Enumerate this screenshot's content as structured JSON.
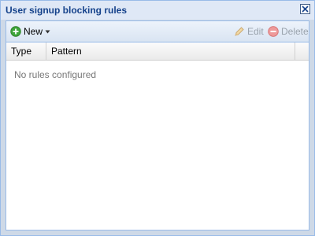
{
  "window": {
    "title": "User signup blocking rules"
  },
  "toolbar": {
    "new_label": "New",
    "edit_label": "Edit",
    "delete_label": "Delete"
  },
  "grid": {
    "columns": [
      "Type",
      "Pattern"
    ],
    "empty_text": "No rules configured"
  },
  "colors": {
    "title_text": "#15428b",
    "panel_border": "#99bbe8",
    "disabled_text": "#9aa3ad",
    "add_icon": "#3fa53a",
    "delete_icon": "#e57272"
  },
  "icons": {
    "close": "close-icon",
    "new": "plus-circle-icon",
    "dropdown": "caret-down-icon",
    "edit": "pencil-icon",
    "delete": "minus-circle-icon"
  }
}
